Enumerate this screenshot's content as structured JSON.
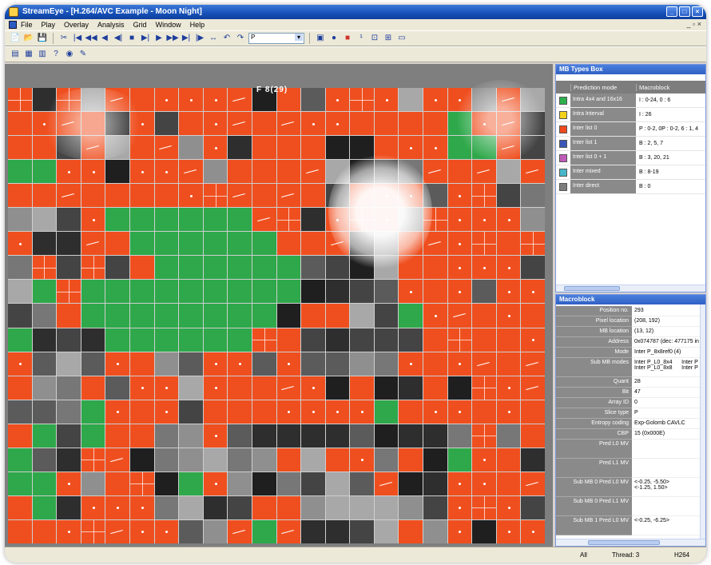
{
  "window": {
    "title": "StreamEye - [H.264/AVC Example - Moon Night]",
    "controls": [
      "_",
      "□",
      "×"
    ]
  },
  "menu": {
    "items": [
      "File",
      "Play",
      "Overlay",
      "Analysis",
      "Grid",
      "Window",
      "Help"
    ],
    "right": "_ ▫ ×"
  },
  "toolbar": {
    "row1": [
      "📄",
      "📂",
      "💾",
      "✂",
      "|◀",
      "◀◀",
      "◀",
      "◀|",
      "■",
      "▶|",
      "▶",
      "▶▶",
      "▶|",
      "|▶",
      "↔",
      "↶",
      "↷"
    ],
    "combo_value": "P",
    "row1_tail": [
      "▣",
      "●",
      "■",
      "¹",
      "⊡",
      "⊞",
      "▭"
    ],
    "row2": [
      "▤",
      "▦",
      "▥",
      "?",
      "◉",
      "✎"
    ]
  },
  "viewer": {
    "frame_label": "F 8(29)"
  },
  "mb_types_panel": {
    "title": "MB Types Box",
    "col_mode": "Prediction mode",
    "col_mb": "Macroblock",
    "rows": [
      {
        "mode": "Intra 4x4 and 16x16",
        "mb": "I : 0-24, 0 : 6",
        "color": "#2eb14c"
      },
      {
        "mode": "Intra Interval",
        "mb": "I : 26",
        "color": "#f3d21b"
      },
      {
        "mode": "Inter list 0",
        "mb": "P : 0-2, 0P : 0-2, 6 : 1, 4",
        "color": "#f04a1e"
      },
      {
        "mode": "Inter list 1",
        "mb": "B : 2, 5, 7",
        "color": "#3a57b7"
      },
      {
        "mode": "Inter list 0 + 1",
        "mb": "B : 3, 20, 21",
        "color": "#c05ab8"
      },
      {
        "mode": "Inter mixed",
        "mb": "B : 8-19",
        "color": "#46b6c8"
      },
      {
        "mode": "Inter direct",
        "mb": "B : 0",
        "color": "#7d7d7d"
      }
    ]
  },
  "mb_info_panel": {
    "title": "Macroblock",
    "rows": [
      {
        "k": "Position no.",
        "v": "293"
      },
      {
        "k": "Pixel location",
        "v": "(208, 192)"
      },
      {
        "k": "MB location",
        "v": "(13, 12)"
      },
      {
        "k": "Address",
        "v": "0x074787 (dec: 477175 in"
      },
      {
        "k": "Mode",
        "v": "Inter P_8x8ref0 (4)"
      },
      {
        "k": "Sub MB modes",
        "v": "Inter P_L0_8x4      Inter P\nInter P_L0_8x8      Inter P"
      },
      {
        "k": "Quant",
        "v": "28"
      },
      {
        "k": "Bit",
        "v": "47"
      },
      {
        "k": "Array ID",
        "v": "0"
      },
      {
        "k": "Slice type",
        "v": "P"
      },
      {
        "k": "Entropy coding",
        "v": "Exp-Golomb CAVLC"
      },
      {
        "k": "CBP",
        "v": "15 (0x000E)"
      },
      {
        "k": "Pred L0 MV",
        "v": ""
      },
      {
        "k": "Pred L1 MV",
        "v": ""
      },
      {
        "k": "Sub MB 0 Pred L0 MV",
        "v": "<-0.25, -5.50>\n<-1.25, 1.50>"
      },
      {
        "k": "Sub MB 0 Pred L1 MV",
        "v": ""
      },
      {
        "k": "Sub MB 1 Pred L0 MV",
        "v": "<-0.25, -6.25>"
      }
    ]
  },
  "status": {
    "left": "",
    "c1": "All",
    "c2": "Thread: 3",
    "c3": "H264"
  }
}
